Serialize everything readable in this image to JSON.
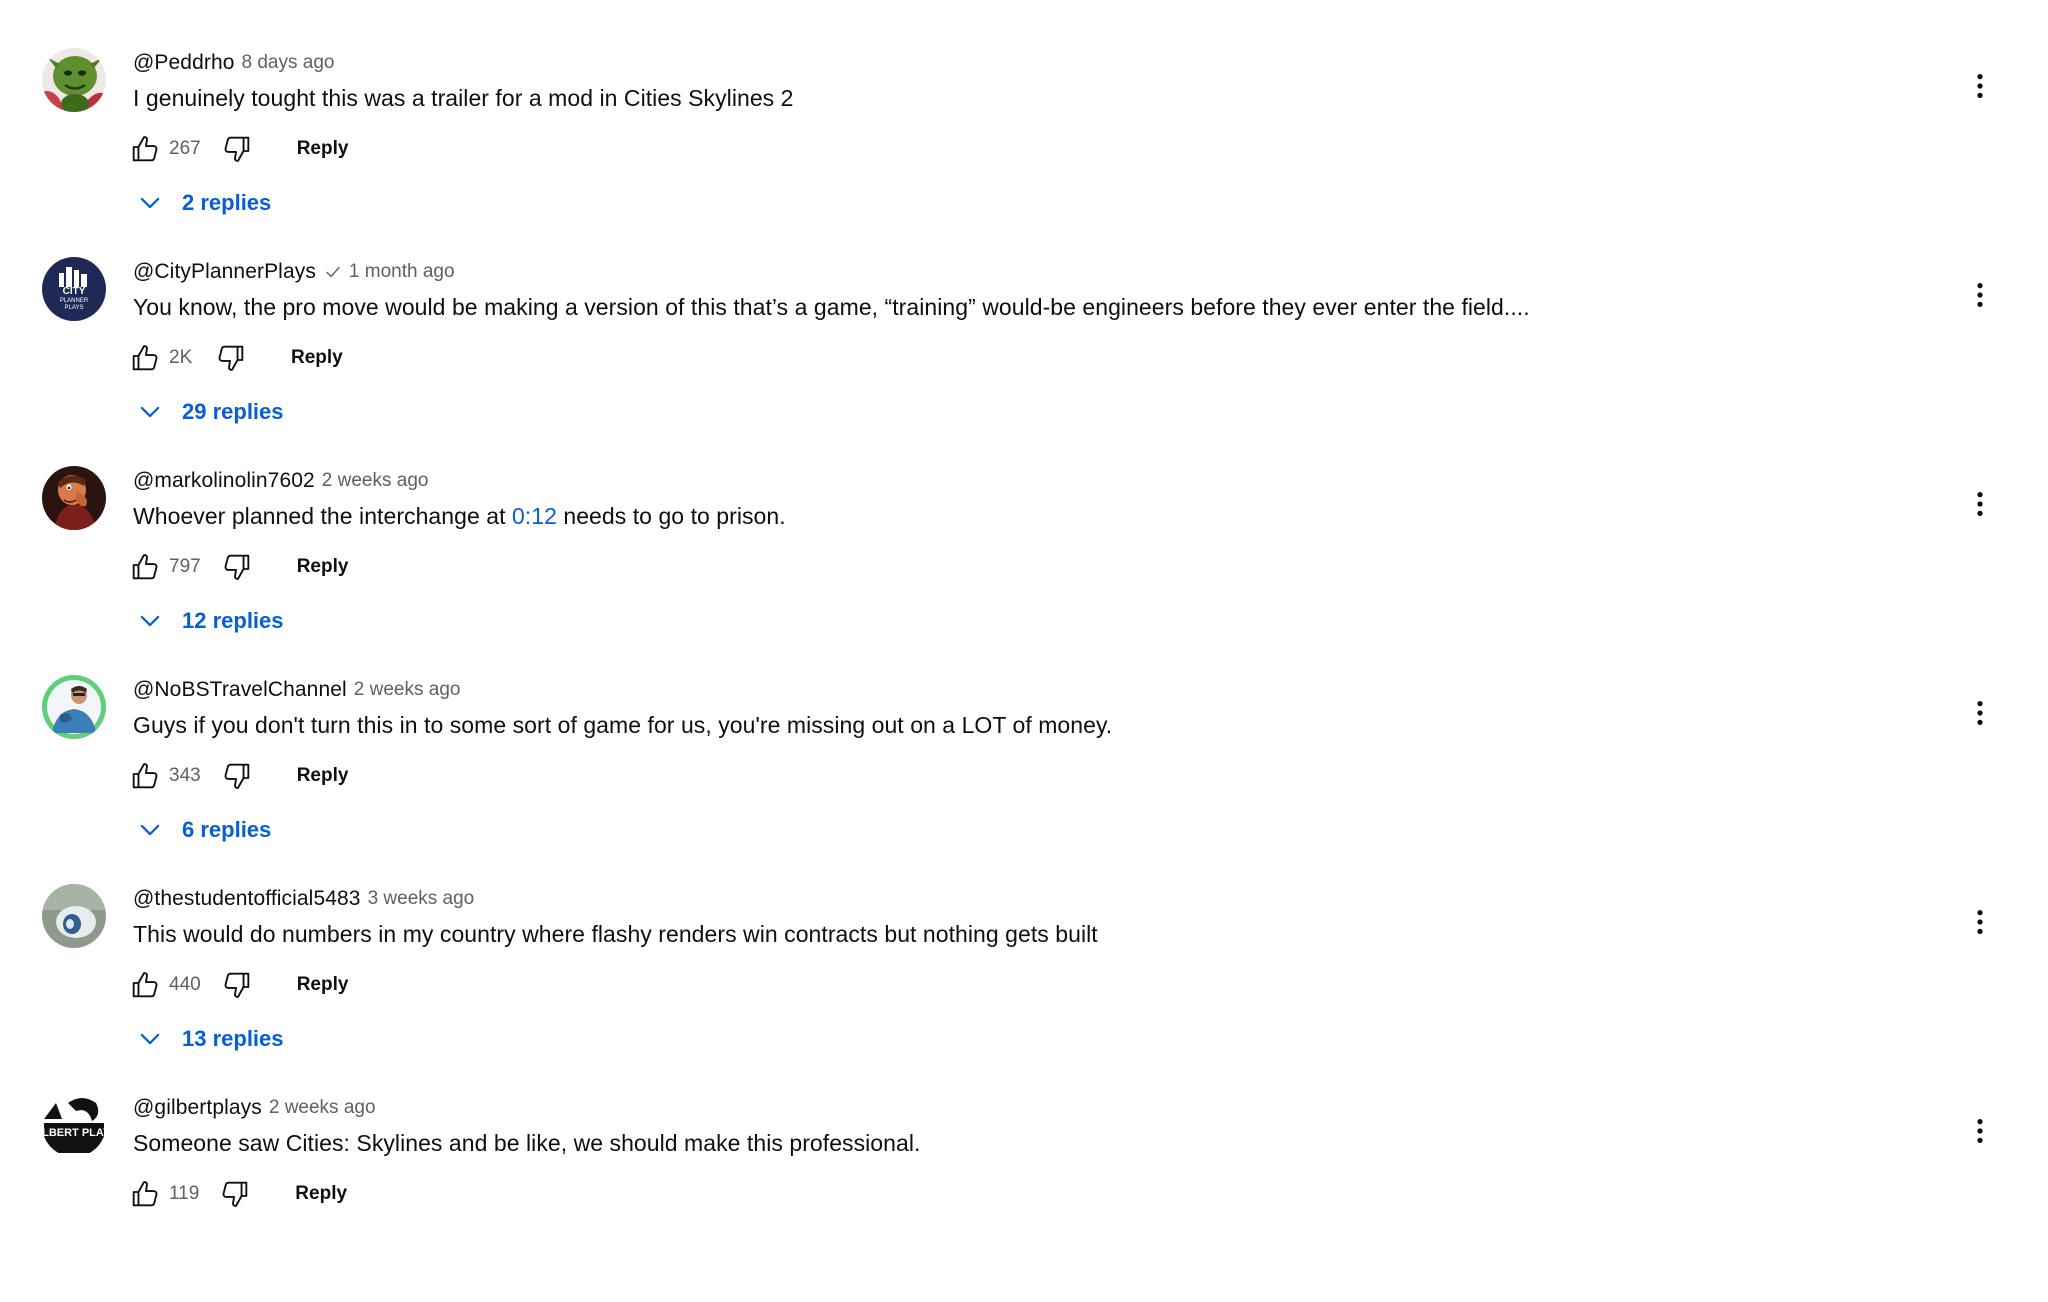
{
  "comments": [
    {
      "author": "@Peddrho",
      "verified": false,
      "time": "8 days ago",
      "text": "I genuinely tought this was a trailer for a mod in Cities Skylines 2",
      "likes": "267",
      "reply_label": "Reply",
      "replies_label": "2 replies",
      "avatar_icon": "green-goblin-avatar"
    },
    {
      "author": "@CityPlannerPlays",
      "verified": true,
      "time": "1 month ago",
      "text": "You know, the pro move would be making a version of this that’s a game, “training” would-be engineers before they ever enter the field....",
      "likes": "2K",
      "reply_label": "Reply",
      "replies_label": "29 replies",
      "avatar_icon": "city-logo-avatar"
    },
    {
      "author": "@markolinolin7602",
      "verified": false,
      "time": "2 weeks ago",
      "text_before": "Whoever planned the interchange at ",
      "text_link": "0:12",
      "text_after": " needs to go to prison.",
      "likes": "797",
      "reply_label": "Reply",
      "replies_label": "12 replies",
      "avatar_icon": "cartoon-character-avatar"
    },
    {
      "author": "@NoBSTravelChannel",
      "verified": false,
      "time": "2 weeks ago",
      "text": "Guys if you don't turn this in to some sort of game for us, you're missing out on a LOT of money.",
      "likes": "343",
      "reply_label": "Reply",
      "replies_label": "6 replies",
      "avatar_icon": "person-photo-avatar"
    },
    {
      "author": "@thestudentofficial5483",
      "verified": false,
      "time": "3 weeks ago",
      "text": "This would do numbers in my country where flashy renders win contracts but nothing gets built",
      "likes": "440",
      "reply_label": "Reply",
      "replies_label": "13 replies",
      "avatar_icon": "object-photo-avatar"
    },
    {
      "author": "@gilbertplays",
      "verified": false,
      "time": "2 weeks ago",
      "text": "Someone saw Cities: Skylines and be like, we should make this professional.",
      "likes": "119",
      "reply_label": "Reply",
      "avatar_icon": "gilbert-logo-avatar",
      "avatar_text": "GILBERT PLAYS"
    }
  ],
  "colors": {
    "link_blue": "#065fd4",
    "secondary_text": "#606060",
    "primary_text": "#0f0f0f"
  }
}
